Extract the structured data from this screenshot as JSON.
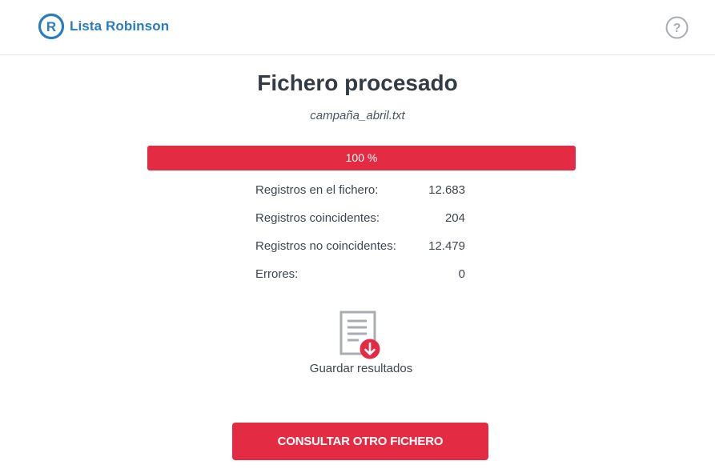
{
  "header": {
    "brand": "Lista Robinson",
    "logo_letter": "R",
    "logo_icon": "lista-robinson-logo-icon",
    "help_icon": "help-question-icon",
    "help_symbol": "?"
  },
  "main": {
    "title": "Fichero procesado",
    "filename": "campaña_abril.txt",
    "progress": {
      "value_percent": 100,
      "label": "100 %"
    },
    "stats": [
      {
        "label": "Registros en el fichero:",
        "value": "12.683"
      },
      {
        "label": "Registros coincidentes:",
        "value": "204"
      },
      {
        "label": "Registros no coincidentes:",
        "value": "12.479"
      },
      {
        "label": "Errores:",
        "value": "0"
      }
    ],
    "save": {
      "label": "Guardar resultados",
      "icon": "document-download-icon"
    },
    "cta_label": "CONSULTAR OTRO FICHERO"
  },
  "colors": {
    "brand_blue": "#2b7bbf",
    "accent_red": "#e32b44",
    "text_dark": "#333b45",
    "icon_gray": "#a9adb3"
  }
}
